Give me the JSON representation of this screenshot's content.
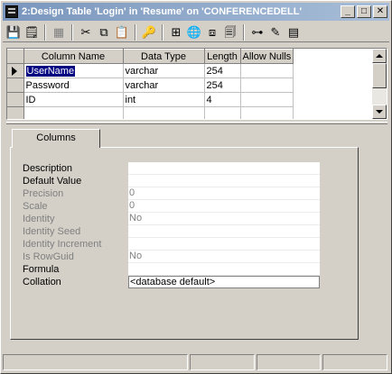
{
  "window": {
    "title": "2:Design Table 'Login' in 'Resume' on 'CONFERENCEDELL'",
    "controls": {
      "minimize": "_",
      "maximize": "□",
      "close": "✕"
    }
  },
  "toolbar": {
    "items": [
      {
        "name": "save-icon",
        "glyph": "💾"
      },
      {
        "name": "properties-icon",
        "glyph": "🗒"
      },
      {
        "name": "new-table-icon",
        "glyph": "▦"
      },
      {
        "name": "cut-icon",
        "glyph": "✂"
      },
      {
        "name": "copy-icon",
        "glyph": "⧉"
      },
      {
        "name": "paste-icon",
        "glyph": "📋"
      },
      {
        "name": "primary-key-icon",
        "glyph": "🔑"
      },
      {
        "name": "relationships-icon",
        "glyph": "⊞"
      },
      {
        "name": "indexes-icon",
        "glyph": "🌐"
      },
      {
        "name": "check-constraints-icon",
        "glyph": "⧈"
      },
      {
        "name": "generate-script-icon",
        "glyph": "🗐"
      },
      {
        "name": "diagram-icon",
        "glyph": "⊶"
      },
      {
        "name": "manage-triggers-icon",
        "glyph": "✎"
      },
      {
        "name": "table-view-icon",
        "glyph": "▤"
      }
    ]
  },
  "grid": {
    "columns": [
      "Column Name",
      "Data Type",
      "Length",
      "Allow Nulls"
    ],
    "rows": [
      {
        "name": "UserName",
        "type": "varchar",
        "length": "254",
        "nulls": ""
      },
      {
        "name": "Password",
        "type": "varchar",
        "length": "254",
        "nulls": ""
      },
      {
        "name": "ID",
        "type": "int",
        "length": "4",
        "nulls": ""
      }
    ]
  },
  "tabs": {
    "columns": "Columns"
  },
  "properties": {
    "description": {
      "label": "Description",
      "value": ""
    },
    "default_value": {
      "label": "Default Value",
      "value": ""
    },
    "precision": {
      "label": "Precision",
      "value": "0"
    },
    "scale": {
      "label": "Scale",
      "value": "0"
    },
    "identity": {
      "label": "Identity",
      "value": "No"
    },
    "identity_seed": {
      "label": "Identity Seed",
      "value": ""
    },
    "identity_increment": {
      "label": "Identity Increment",
      "value": ""
    },
    "is_rowguid": {
      "label": "Is RowGuid",
      "value": "No"
    },
    "formula": {
      "label": "Formula",
      "value": ""
    },
    "collation": {
      "label": "Collation",
      "value": "<database default>"
    }
  }
}
